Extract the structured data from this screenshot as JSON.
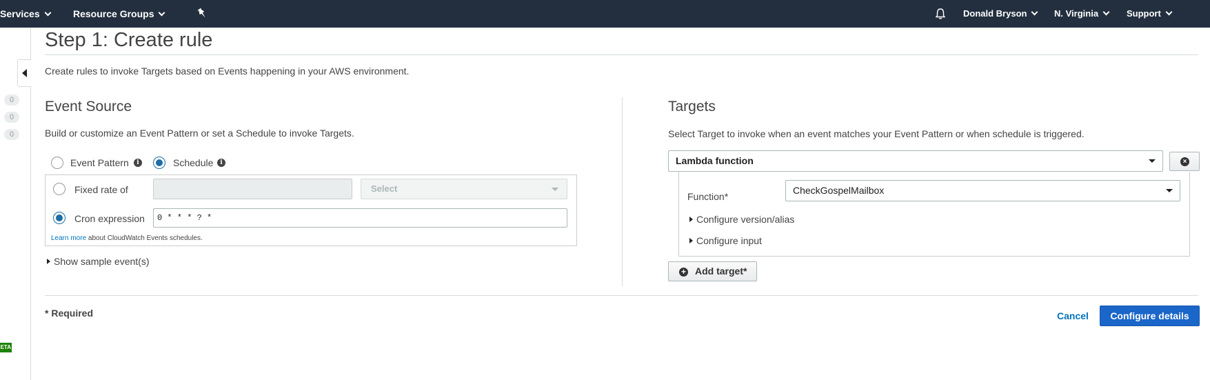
{
  "topnav": {
    "services_label": "Services",
    "resource_groups_label": "Resource Groups",
    "user_label": "Donald Bryson",
    "region_label": "N. Virginia",
    "support_label": "Support",
    "background_color": "#232f3e"
  },
  "sidebar": {
    "counts": [
      "0",
      "0",
      "0"
    ],
    "beta_label": "ETA"
  },
  "page": {
    "title": "Step 1: Create rule",
    "intro": "Create rules to invoke Targets based on Events happening in your AWS environment."
  },
  "event_source": {
    "title": "Event Source",
    "description": "Build or customize an Event Pattern or set a Schedule to invoke Targets.",
    "event_pattern_label": "Event Pattern",
    "schedule_label": "Schedule",
    "selected_mode": "Schedule",
    "fixed_rate_label": "Fixed rate of",
    "fixed_rate_value": "",
    "fixed_rate_unit_placeholder": "Select",
    "cron_label": "Cron expression",
    "cron_value": "0 * * * ? *",
    "selected_schedule_type": "Cron expression",
    "learn_more_link": "Learn more",
    "learn_more_suffix": "about CloudWatch Events schedules.",
    "show_sample_label": "Show sample event(s)"
  },
  "targets": {
    "title": "Targets",
    "description": "Select Target to invoke when an event matches your Event Pattern or when schedule is triggered.",
    "target_type": "Lambda function",
    "function_label": "Function*",
    "function_value": "CheckGospelMailbox",
    "configure_version_label": "Configure version/alias",
    "configure_input_label": "Configure input",
    "add_target_label": "Add target*"
  },
  "footer": {
    "required_note": "* Required",
    "cancel_label": "Cancel",
    "configure_details_label": "Configure details",
    "primary_color": "#1b66c9",
    "link_color": "#0073bb"
  }
}
